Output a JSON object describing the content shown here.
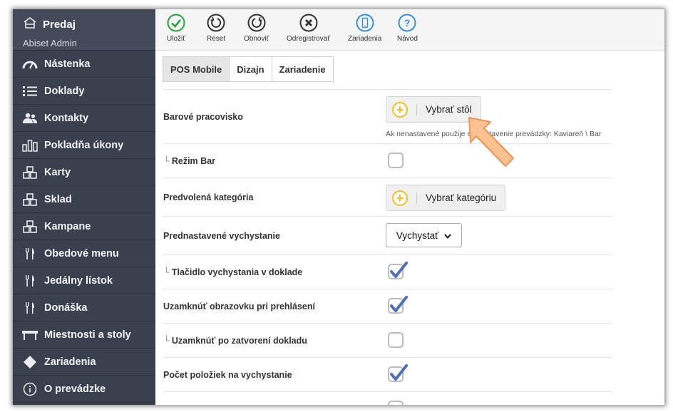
{
  "sidebar": {
    "brand_title": "Predaj",
    "brand_sub": "Abiset Admin",
    "items": [
      {
        "label": "Nástenka",
        "icon": "dashboard-icon"
      },
      {
        "label": "Doklady",
        "icon": "list-icon"
      },
      {
        "label": "Kontakty",
        "icon": "users-icon"
      },
      {
        "label": "Pokladňa úkony",
        "icon": "bars-icon"
      },
      {
        "label": "Karty",
        "icon": "cubes-icon"
      },
      {
        "label": "Sklad",
        "icon": "cubes-icon"
      },
      {
        "label": "Kampane",
        "icon": "cubes-icon"
      },
      {
        "label": "Obedové menu",
        "icon": "cutlery-icon"
      },
      {
        "label": "Jedálny lístok",
        "icon": "cutlery-icon"
      },
      {
        "label": "Donáška",
        "icon": "cutlery-icon"
      },
      {
        "label": "Miestnosti a stoly",
        "icon": "table-icon"
      },
      {
        "label": "Zariadenia",
        "icon": "diamond-icon"
      },
      {
        "label": "O prevádzke",
        "icon": "info-icon"
      }
    ]
  },
  "toolbar": {
    "save": "Uložiť",
    "reset": "Reset",
    "refresh": "Obnoviť",
    "unregister": "Odregistrovať",
    "devices": "Zariadenia",
    "help": "Návod"
  },
  "tabs": [
    "POS Mobile",
    "Dizajn",
    "Zariadenie"
  ],
  "form": {
    "bar_station_label": "Barové pracovisko",
    "bar_station_button": "Vybrať stôl",
    "bar_station_hint": "Ak nenastavené použije sa nastavenie prevádzky: Kaviareň \\ Bar",
    "bar_mode_prefix": "└",
    "bar_mode_label": "Režim Bar",
    "bar_mode_checked": false,
    "default_category_label": "Predvolená kategória",
    "default_category_button": "Vybrať kategóriu",
    "default_dispatch_label": "Prednastavené vychystanie",
    "default_dispatch_value": "Vychystať",
    "dispatch_button_prefix": "└",
    "dispatch_button_label": "Tlačidlo vychystania v doklade",
    "dispatch_button_checked": true,
    "lock_screen_label": "Uzamknúť obrazovku pri prehlásení",
    "lock_screen_checked": true,
    "lock_after_close_prefix": "└",
    "lock_after_close_label": "Uzamknúť po zatvorení dokladu",
    "lock_after_close_checked": false,
    "items_count_label": "Počet položiek na vychystanie",
    "items_count_checked": true
  },
  "colors": {
    "sidebar_bg": "#3a404d",
    "save_green": "#2e9e44",
    "blue_accent": "#3a8fd6",
    "plus_yellow": "#f0c020",
    "check_blue": "#4d6fb3",
    "arrow_orange": "#f5a05a"
  }
}
